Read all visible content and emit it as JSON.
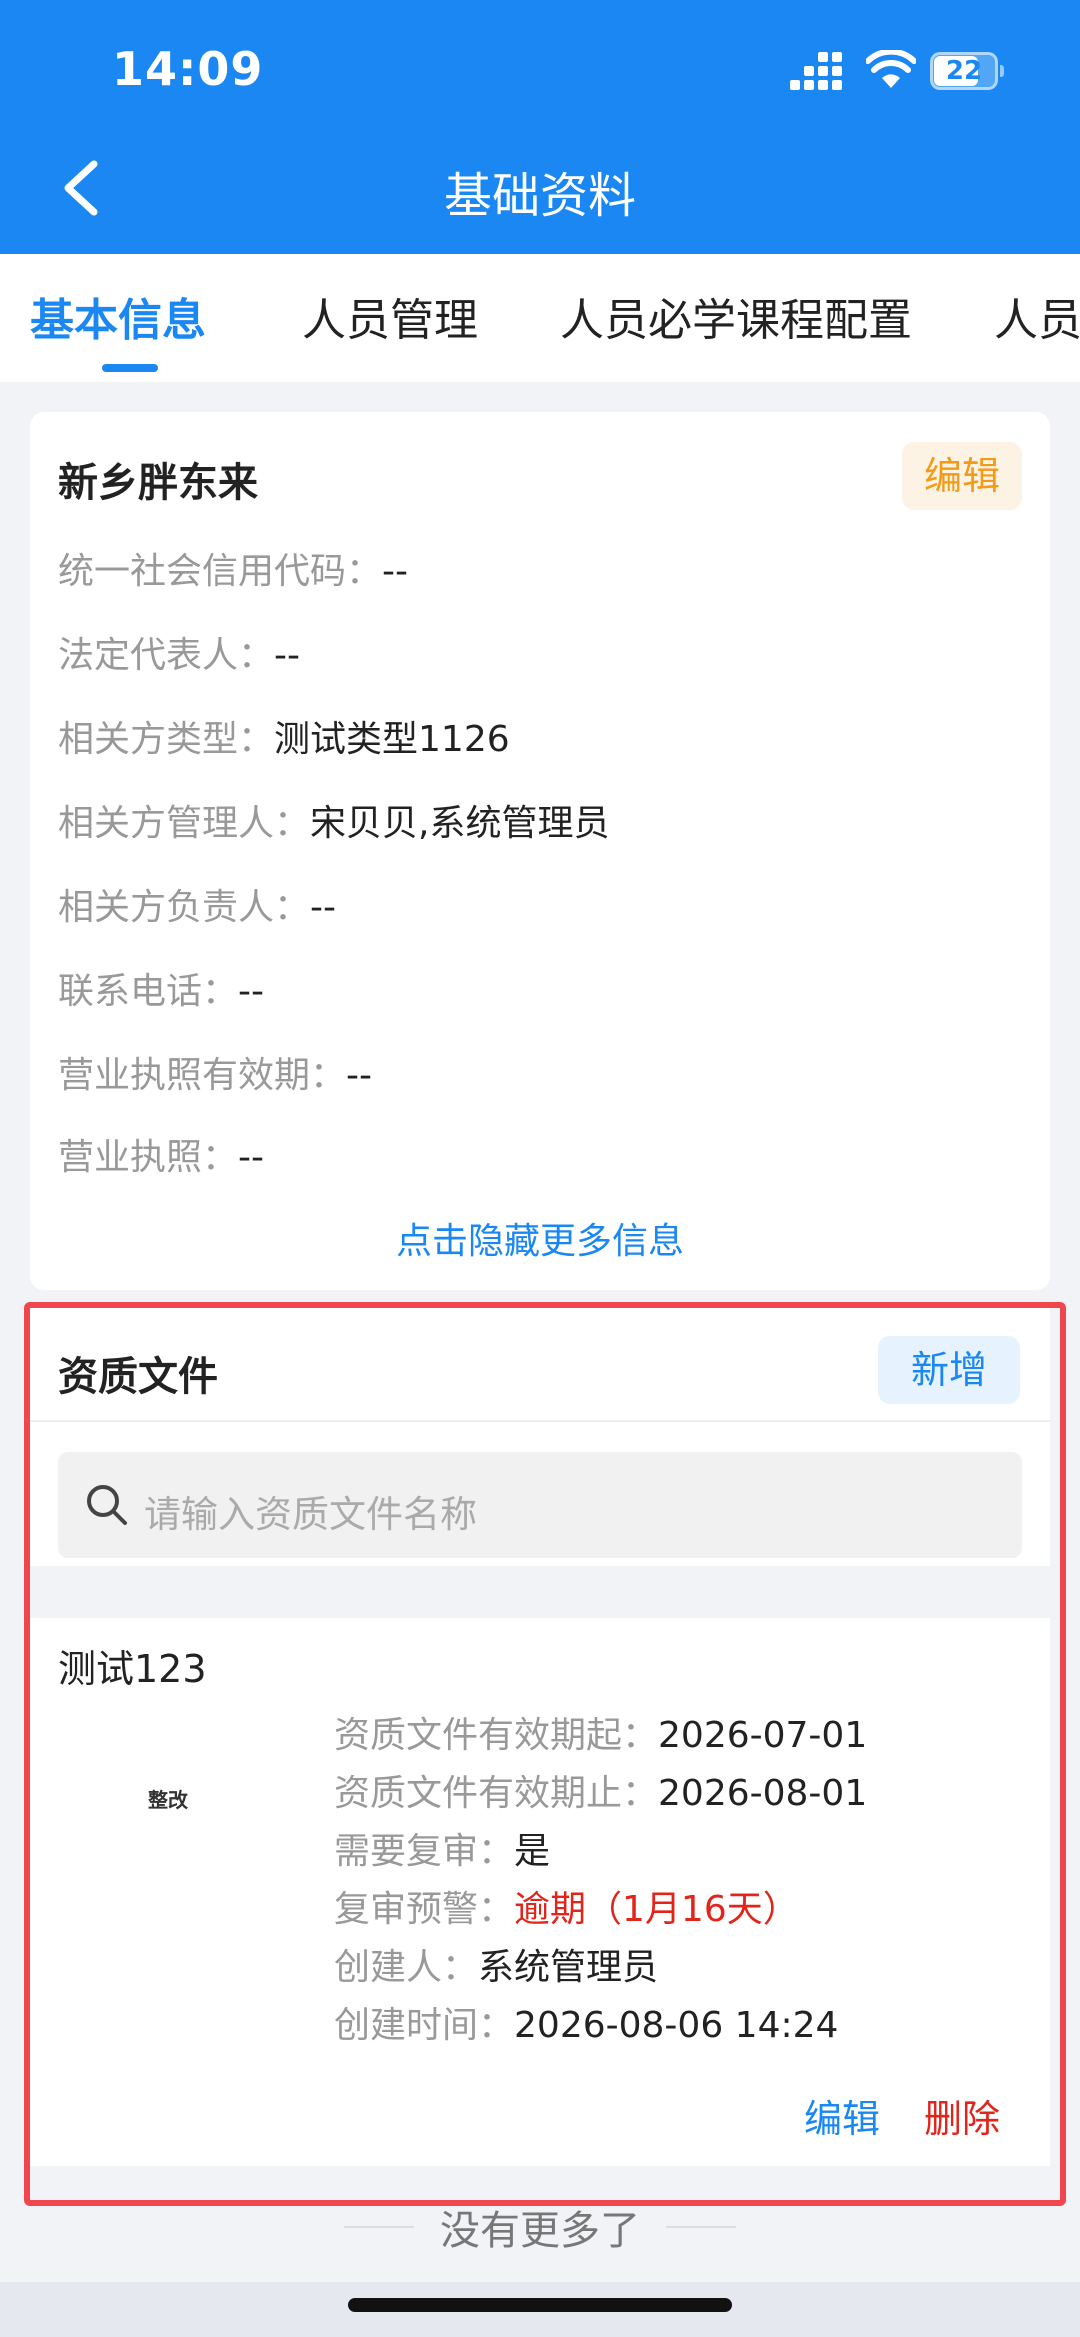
{
  "status_bar": {
    "time": "14:09",
    "battery": "22"
  },
  "nav": {
    "title": "基础资料"
  },
  "tabs": [
    {
      "label": "基本信息"
    },
    {
      "label": "人员管理"
    },
    {
      "label": "人员必学课程配置"
    },
    {
      "label": "人员"
    }
  ],
  "company_card": {
    "name": "新乡胖东来",
    "edit_label": "编辑",
    "rows": [
      {
        "label": "统一社会信用代码：",
        "value": "--"
      },
      {
        "label": "法定代表人：",
        "value": "--"
      },
      {
        "label": "相关方类型：",
        "value": "测试类型1126"
      },
      {
        "label": "相关方管理人：",
        "value": "宋贝贝,系统管理员"
      },
      {
        "label": "相关方负责人：",
        "value": "--"
      },
      {
        "label": "联系电话：",
        "value": "--"
      },
      {
        "label": "营业执照有效期：",
        "value": "--"
      },
      {
        "label": "营业执照：",
        "value": "--"
      }
    ],
    "toggle_label": "点击隐藏更多信息"
  },
  "qualification": {
    "title": "资质文件",
    "add_label": "新增",
    "search_placeholder": "请输入资质文件名称",
    "items": [
      {
        "name": "测试123",
        "thumb_label": "整改",
        "rows": [
          {
            "label": "资质文件有效期起：",
            "value": "2026-07-01"
          },
          {
            "label": "资质文件有效期止：",
            "value": "2026-08-01"
          },
          {
            "label": "需要复审：",
            "value": "是"
          },
          {
            "label": "复审预警：",
            "value": "逾期（1月16天）"
          },
          {
            "label": "创建人：",
            "value": "系统管理员"
          },
          {
            "label": "创建时间：",
            "value": "2026-08-06 14:24"
          }
        ],
        "edit_label": "编辑",
        "delete_label": "删除"
      }
    ]
  },
  "footer": {
    "no_more": "没有更多了"
  },
  "colors": {
    "primary": "#1a87f3",
    "warning": "#f39a16",
    "danger": "#e1251b",
    "highlight": "#f0474f"
  }
}
